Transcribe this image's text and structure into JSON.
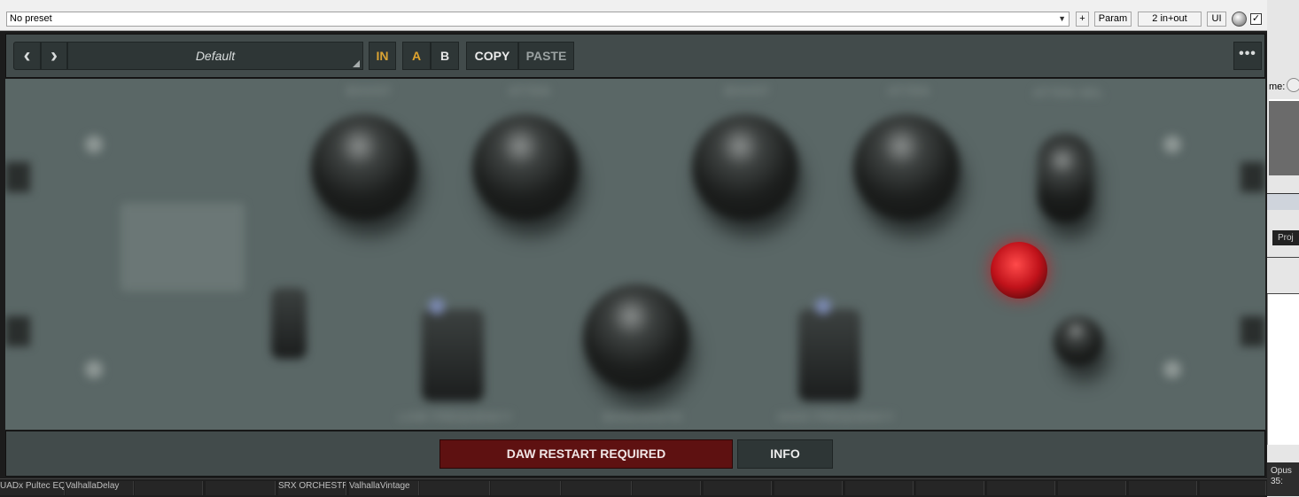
{
  "host": {
    "preset": "No preset",
    "buttons": {
      "add": "+",
      "param": "Param",
      "io": "2 in+out",
      "ui": "UI"
    },
    "checkbox_mark": "✓",
    "right_edge": {
      "label": "me:",
      "tab": "Proj",
      "footer_line1": "Opus",
      "footer_line2": "35:"
    }
  },
  "plugin": {
    "toolbar": {
      "prev_icon": "chevron-left-icon",
      "next_icon": "chevron-right-icon",
      "prev_glyph": "‹",
      "next_glyph": "›",
      "preset_name": "Default",
      "in_label": "IN",
      "a_label": "A",
      "b_label": "B",
      "copy_label": "COPY",
      "paste_label": "PASTE",
      "more_glyph": "•••"
    },
    "faceplate": {
      "labels": {
        "boost_low": "BOOST",
        "atten_low": "ATTEN",
        "boost_high": "BOOST",
        "atten_high": "ATTEN",
        "atten_sel": "ATTEN SEL",
        "low_frequency": "LOW FREQUENCY",
        "bandwidth": "BANDWIDTH",
        "high_frequency": "HIGH FREQUENCY"
      }
    },
    "bottom": {
      "restart_label": "DAW RESTART REQUIRED",
      "info_label": "INFO"
    },
    "colors": {
      "toolbar_bg": "#424b4b",
      "button_bg": "#2e3636",
      "accent_amber": "#e0a42e",
      "restart_bg": "#5e1111",
      "led_red": "#c0121a"
    }
  },
  "taskbar": {
    "items": [
      "UADx Pultec EQP",
      "ValhallaDelay",
      "",
      "",
      "SRX ORCHESTRA",
      "ValhallaVintage",
      "",
      "",
      "",
      "",
      "",
      "",
      "",
      "",
      "",
      "",
      "",
      ""
    ]
  }
}
